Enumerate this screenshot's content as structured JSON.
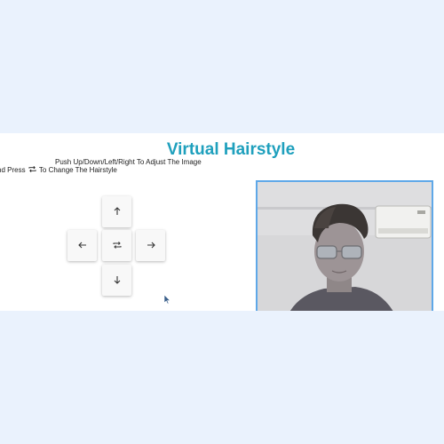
{
  "app": {
    "title": "Virtual Hairstyle"
  },
  "instructions": {
    "line1": "Push Up/Down/Left/Right To Adjust The Image",
    "line2_before": "nd Press",
    "line2_after": "To Change The Hairstyle"
  },
  "controls": {
    "up_icon": "arrow-up-icon",
    "down_icon": "arrow-down-icon",
    "left_icon": "arrow-left-icon",
    "right_icon": "arrow-right-icon",
    "swap_icon": "swap-icon"
  },
  "colors": {
    "title": "#1fa0bd",
    "page_background": "#eaf2fd",
    "camera_border": "#5fa8e8"
  }
}
